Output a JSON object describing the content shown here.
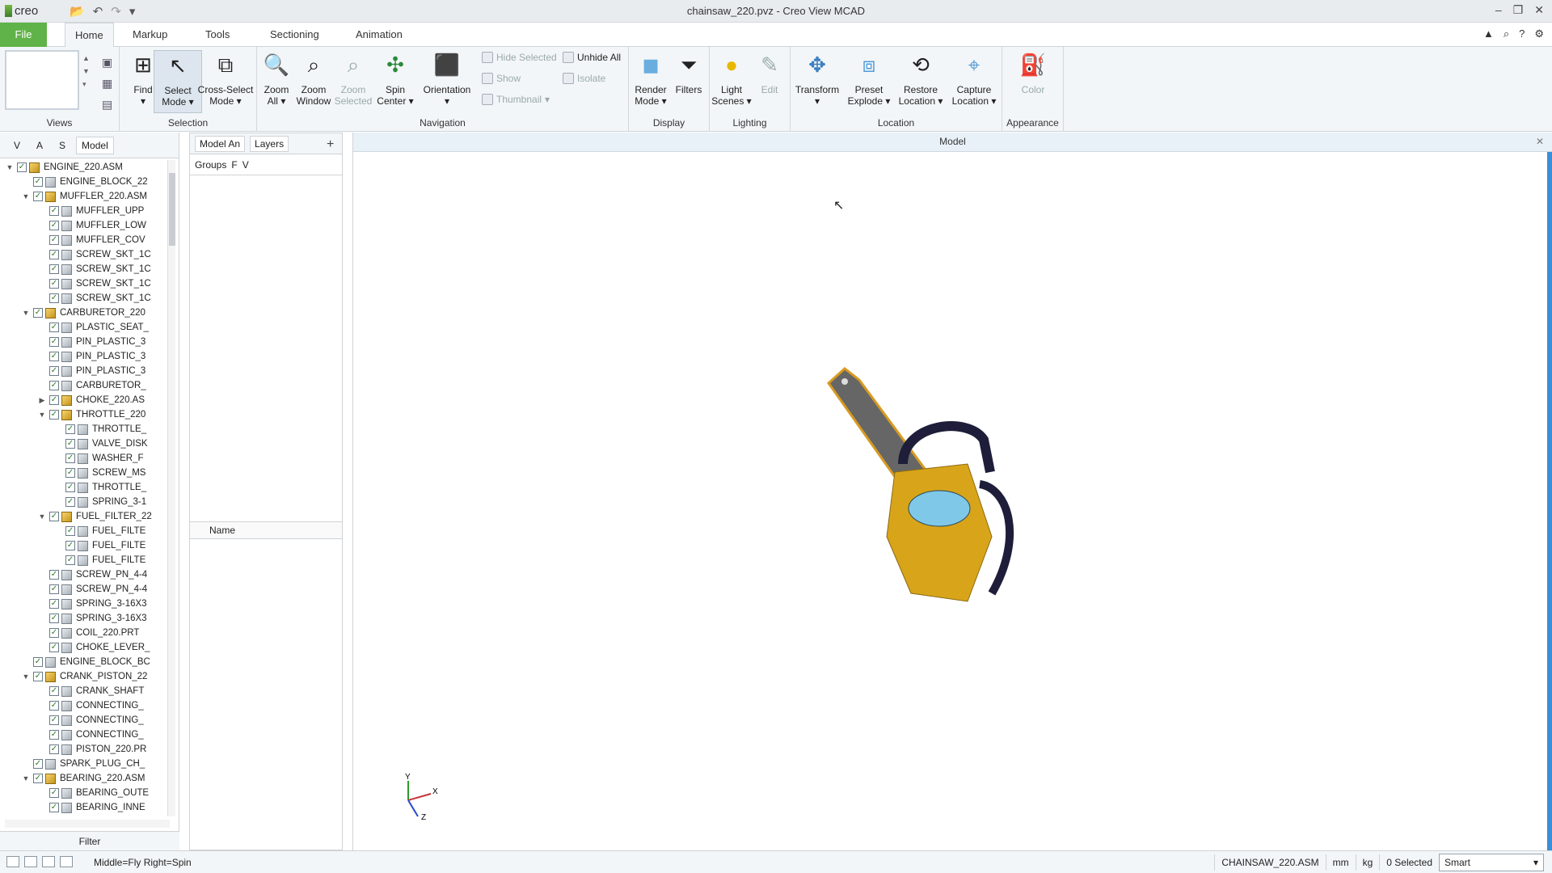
{
  "app": {
    "logo": "creo",
    "title": "chainsaw_220.pvz - Creo View MCAD"
  },
  "tabs": [
    "File",
    "Home",
    "Markup",
    "Tools",
    "Sectioning",
    "Animation"
  ],
  "ribbon": {
    "views_label": "Views",
    "selection_label": "Selection",
    "navigation_label": "Navigation",
    "display_label": "Display",
    "lighting_label": "Lighting",
    "location_label": "Location",
    "appearance_label": "Appearance",
    "find": "Find",
    "select_mode": "Select Mode",
    "cross_select_mode": "Cross-Select Mode",
    "zoom_all": "Zoom All",
    "zoom_window": "Zoom Window",
    "zoom_selected": "Zoom Selected",
    "spin_center": "Spin Center",
    "orientation": "Orientation",
    "hide_selected": "Hide Selected",
    "unhide_all": "Unhide All",
    "show": "Show",
    "isolate": "Isolate",
    "thumbnail": "Thumbnail",
    "render_mode": "Render Mode",
    "filters": "Filters",
    "light_scenes": "Light Scenes",
    "edit": "Edit",
    "transform": "Transform",
    "preset_explode": "Preset Explode",
    "restore_location": "Restore Location",
    "capture_location": "Capture Location",
    "color": "Color"
  },
  "left_panel": {
    "tabs": [
      "V",
      "A",
      "S",
      "Model"
    ],
    "filter": "Filter",
    "tree": [
      {
        "indent": 0,
        "tw": "▼",
        "type": "asm",
        "label": "ENGINE_220.ASM"
      },
      {
        "indent": 1,
        "tw": "",
        "type": "part",
        "label": "ENGINE_BLOCK_22"
      },
      {
        "indent": 1,
        "tw": "▼",
        "type": "asm",
        "label": "MUFFLER_220.ASM"
      },
      {
        "indent": 2,
        "tw": "",
        "type": "part",
        "label": "MUFFLER_UPP"
      },
      {
        "indent": 2,
        "tw": "",
        "type": "part",
        "label": "MUFFLER_LOW"
      },
      {
        "indent": 2,
        "tw": "",
        "type": "part",
        "label": "MUFFLER_COV"
      },
      {
        "indent": 2,
        "tw": "",
        "type": "part",
        "label": "SCREW_SKT_1C"
      },
      {
        "indent": 2,
        "tw": "",
        "type": "part",
        "label": "SCREW_SKT_1C"
      },
      {
        "indent": 2,
        "tw": "",
        "type": "part",
        "label": "SCREW_SKT_1C"
      },
      {
        "indent": 2,
        "tw": "",
        "type": "part",
        "label": "SCREW_SKT_1C"
      },
      {
        "indent": 1,
        "tw": "▼",
        "type": "asm",
        "label": "CARBURETOR_220"
      },
      {
        "indent": 2,
        "tw": "",
        "type": "part",
        "label": "PLASTIC_SEAT_"
      },
      {
        "indent": 2,
        "tw": "",
        "type": "part",
        "label": "PIN_PLASTIC_3"
      },
      {
        "indent": 2,
        "tw": "",
        "type": "part",
        "label": "PIN_PLASTIC_3"
      },
      {
        "indent": 2,
        "tw": "",
        "type": "part",
        "label": "PIN_PLASTIC_3"
      },
      {
        "indent": 2,
        "tw": "",
        "type": "part",
        "label": "CARBURETOR_"
      },
      {
        "indent": 2,
        "tw": "▶",
        "type": "asm",
        "label": "CHOKE_220.AS"
      },
      {
        "indent": 2,
        "tw": "▼",
        "type": "asm",
        "label": "THROTTLE_220"
      },
      {
        "indent": 3,
        "tw": "",
        "type": "part",
        "label": "THROTTLE_"
      },
      {
        "indent": 3,
        "tw": "",
        "type": "part",
        "label": "VALVE_DISK"
      },
      {
        "indent": 3,
        "tw": "",
        "type": "part",
        "label": "WASHER_F"
      },
      {
        "indent": 3,
        "tw": "",
        "type": "part",
        "label": "SCREW_MS"
      },
      {
        "indent": 3,
        "tw": "",
        "type": "part",
        "label": "THROTTLE_"
      },
      {
        "indent": 3,
        "tw": "",
        "type": "part",
        "label": "SPRING_3-1"
      },
      {
        "indent": 2,
        "tw": "▼",
        "type": "asm",
        "label": "FUEL_FILTER_22"
      },
      {
        "indent": 3,
        "tw": "",
        "type": "part",
        "label": "FUEL_FILTE"
      },
      {
        "indent": 3,
        "tw": "",
        "type": "part",
        "label": "FUEL_FILTE"
      },
      {
        "indent": 3,
        "tw": "",
        "type": "part",
        "label": "FUEL_FILTE"
      },
      {
        "indent": 2,
        "tw": "",
        "type": "part",
        "label": "SCREW_PN_4-4"
      },
      {
        "indent": 2,
        "tw": "",
        "type": "part",
        "label": "SCREW_PN_4-4"
      },
      {
        "indent": 2,
        "tw": "",
        "type": "part",
        "label": "SPRING_3-16X3"
      },
      {
        "indent": 2,
        "tw": "",
        "type": "part",
        "label": "SPRING_3-16X3"
      },
      {
        "indent": 2,
        "tw": "",
        "type": "part",
        "label": "COIL_220.PRT"
      },
      {
        "indent": 2,
        "tw": "",
        "type": "part",
        "label": "CHOKE_LEVER_"
      },
      {
        "indent": 1,
        "tw": "",
        "type": "part",
        "label": "ENGINE_BLOCK_BC"
      },
      {
        "indent": 1,
        "tw": "▼",
        "type": "asm",
        "label": "CRANK_PISTON_22"
      },
      {
        "indent": 2,
        "tw": "",
        "type": "part",
        "label": "CRANK_SHAFT"
      },
      {
        "indent": 2,
        "tw": "",
        "type": "part",
        "label": "CONNECTING_"
      },
      {
        "indent": 2,
        "tw": "",
        "type": "part",
        "label": "CONNECTING_"
      },
      {
        "indent": 2,
        "tw": "",
        "type": "part",
        "label": "CONNECTING_"
      },
      {
        "indent": 2,
        "tw": "",
        "type": "part",
        "label": "PISTON_220.PR"
      },
      {
        "indent": 1,
        "tw": "",
        "type": "part",
        "label": "SPARK_PLUG_CH_"
      },
      {
        "indent": 1,
        "tw": "▼",
        "type": "asm",
        "label": "BEARING_220.ASM"
      },
      {
        "indent": 2,
        "tw": "",
        "type": "part",
        "label": "BEARING_OUTE"
      },
      {
        "indent": 2,
        "tw": "",
        "type": "part",
        "label": "BEARING_INNE"
      }
    ]
  },
  "mid_panel": {
    "tabs": [
      "Model An",
      "Layers"
    ],
    "subtabs": [
      "Groups",
      "F",
      "V"
    ],
    "name_header": "Name"
  },
  "viewport": {
    "header": "Model",
    "triad": {
      "x": "X",
      "y": "Y",
      "z": "Z"
    }
  },
  "status": {
    "hint": "Middle=Fly  Right=Spin",
    "model": "CHAINSAW_220.ASM",
    "unit_length": "mm",
    "unit_mass": "kg",
    "selected": "0 Selected",
    "filter": "Smart"
  }
}
